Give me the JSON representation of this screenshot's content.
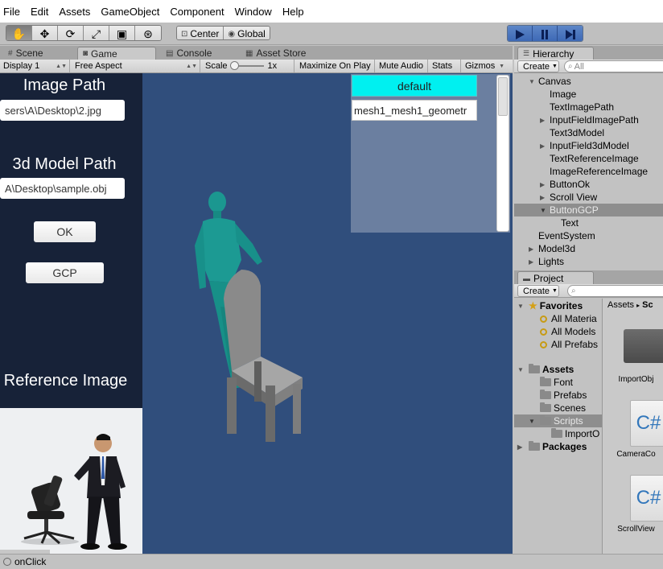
{
  "menu": [
    "File",
    "Edit",
    "Assets",
    "GameObject",
    "Component",
    "Window",
    "Help"
  ],
  "toolbar": {
    "tools": [
      {
        "name": "hand-tool",
        "glyph": "✋"
      },
      {
        "name": "move-tool",
        "glyph": "✥"
      },
      {
        "name": "rotate-tool",
        "glyph": "⟳"
      },
      {
        "name": "scale-tool",
        "glyph": "⤢"
      },
      {
        "name": "rect-tool",
        "glyph": "▣"
      },
      {
        "name": "transform-tool",
        "glyph": "⊛"
      }
    ],
    "pivot_label": "Center",
    "space_label": "Global"
  },
  "tabs": {
    "scene": "Scene",
    "game": "Game",
    "console": "Console",
    "asset_store": "Asset Store"
  },
  "gamebar": {
    "display": "Display 1",
    "aspect": "Free Aspect",
    "scale_label": "Scale",
    "scale_value": "1x",
    "maximize": "Maximize On Play",
    "mute": "Mute Audio",
    "stats": "Stats",
    "gizmos": "Gizmos"
  },
  "game_ui": {
    "image_path_title": "Image Path",
    "image_path_value": "sers\\A\\Desktop\\2.jpg",
    "model_path_title": "3d Model Path",
    "model_path_value": "A\\Desktop\\sample.obj",
    "ok_label": "OK",
    "gcp_label": "GCP",
    "reference_title": "Reference Image",
    "scroll_items": [
      "default",
      "mesh1_mesh1_geometr"
    ]
  },
  "hierarchy": {
    "tab": "Hierarchy",
    "create": "Create",
    "search_placeholder": "All",
    "items": [
      "Canvas",
      "Image",
      "TextImagePath",
      "InputFieldImagePath",
      "Text3dModel",
      "InputField3dModel",
      "TextReferenceImage",
      "ImageReferenceImage",
      "ButtonOk",
      "Scroll View",
      "ButtonGCP",
      "Text",
      "EventSystem",
      "Model3d",
      "Lights"
    ]
  },
  "project": {
    "tab": "Project",
    "create": "Create",
    "tree": [
      "Favorites",
      "All Materia",
      "All Models",
      "All Prefabs",
      "Assets",
      "Font",
      "Prefabs",
      "Scenes",
      "Scripts",
      "ImportO",
      "Packages"
    ],
    "breadcrumb_root": "Assets",
    "breadcrumb_sep": "▸",
    "breadcrumb_leaf": "Sc",
    "assets": [
      "ImportObj",
      "CameraCo",
      "ScrollView"
    ],
    "cs_glyph": "C#"
  },
  "status": "onClick",
  "colors": {
    "game_bg": "#304e7c",
    "left_panel": "#172238",
    "default_button": "#00f0f0",
    "figure": "#199a93",
    "chair": "#7a7a7a"
  }
}
